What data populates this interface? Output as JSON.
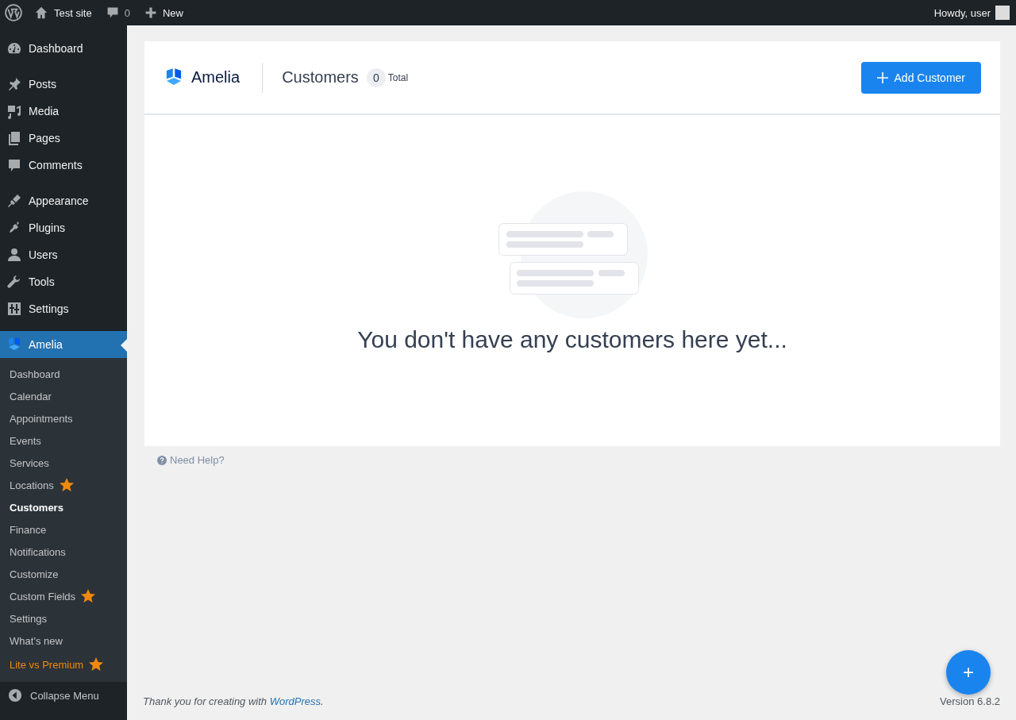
{
  "admin_bar": {
    "site_name": "Test site",
    "comments_count": "0",
    "new_label": "New",
    "greeting": "Howdy, user"
  },
  "sidebar": {
    "menu_groups": [
      [
        {
          "label": "Dashboard",
          "selected": false
        }
      ],
      [
        {
          "label": "Posts",
          "selected": false
        },
        {
          "label": "Media",
          "selected": false
        },
        {
          "label": "Pages",
          "selected": false
        },
        {
          "label": "Comments",
          "selected": false
        }
      ],
      [
        {
          "label": "Appearance",
          "selected": false
        },
        {
          "label": "Plugins",
          "selected": false
        },
        {
          "label": "Users",
          "selected": false
        },
        {
          "label": "Tools",
          "selected": false
        },
        {
          "label": "Settings",
          "selected": false
        }
      ],
      [
        {
          "label": "Amelia",
          "selected": true
        }
      ]
    ],
    "submenu": [
      {
        "label": "Dashboard",
        "selected": false,
        "starred": false,
        "kind": "link"
      },
      {
        "label": "Calendar",
        "selected": false,
        "starred": false,
        "kind": "link"
      },
      {
        "label": "Appointments",
        "selected": false,
        "starred": false,
        "kind": "link"
      },
      {
        "label": "Events",
        "selected": false,
        "starred": false,
        "kind": "link"
      },
      {
        "label": "Services",
        "selected": false,
        "starred": false,
        "kind": "link"
      },
      {
        "label": "Locations",
        "selected": false,
        "starred": true,
        "kind": "link"
      },
      {
        "label": "Customers",
        "selected": true,
        "starred": false,
        "kind": "link"
      },
      {
        "label": "Finance",
        "selected": false,
        "starred": false,
        "kind": "link"
      },
      {
        "label": "Notifications",
        "selected": false,
        "starred": false,
        "kind": "link"
      },
      {
        "label": "Customize",
        "selected": false,
        "starred": false,
        "kind": "link"
      },
      {
        "label": "Custom Fields",
        "selected": false,
        "starred": true,
        "kind": "link"
      },
      {
        "label": "Settings",
        "selected": false,
        "starred": false,
        "kind": "link"
      },
      {
        "label": "What’s new",
        "selected": false,
        "starred": false,
        "kind": "link"
      },
      {
        "label": "Lite vs Premium",
        "selected": false,
        "starred": true,
        "kind": "promo"
      }
    ],
    "collapse_label": "Collapse Menu"
  },
  "header": {
    "logo_text": "Amelia",
    "title": "Customers",
    "count": "0",
    "count_label": "Total",
    "add_button": "Add Customer"
  },
  "empty_state": {
    "message": "You don't have any customers here yet..."
  },
  "help_link": "Need Help?",
  "fab": "+",
  "footer": {
    "thanks": "Thank you for creating with ",
    "link": "WordPress",
    "after": ".",
    "version": "Version 6.8.2"
  }
}
